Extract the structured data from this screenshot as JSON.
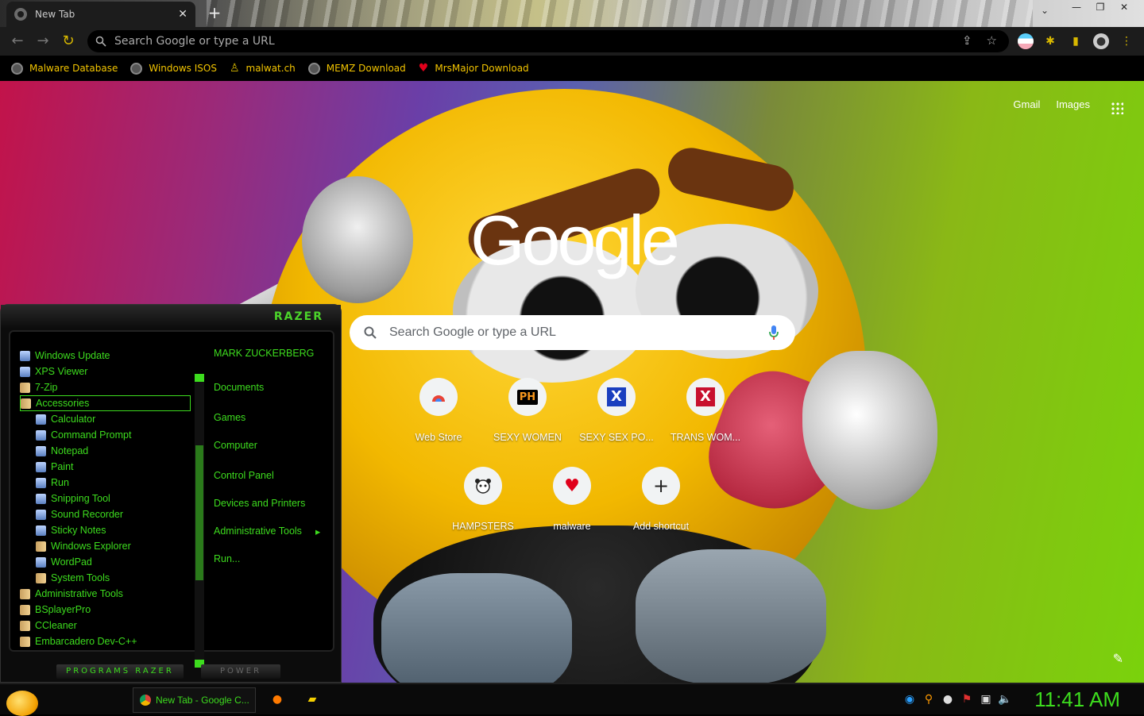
{
  "browser": {
    "tab": {
      "title": "New Tab",
      "close": "✕"
    },
    "newtab_symbol": "+",
    "window_controls": [
      "—",
      "❐",
      "✕"
    ],
    "omnibox": {
      "placeholder": "Search Google or type a URL"
    },
    "bookmarks": [
      {
        "label": "Malware Database",
        "icon": "globe-icon"
      },
      {
        "label": "Windows ISOS",
        "icon": "globe-icon"
      },
      {
        "label": "malwat.ch",
        "icon": "person-icon"
      },
      {
        "label": "MEMZ Download",
        "icon": "globe-icon"
      },
      {
        "label": "MrsMajor Download",
        "icon": "heart-icon"
      }
    ]
  },
  "ntp": {
    "links": {
      "gmail": "Gmail",
      "images": "Images"
    },
    "logo": "Google",
    "search_placeholder": "Search Google or type a URL",
    "shortcuts": [
      {
        "label": "Web Store",
        "icon": "web-store-icon"
      },
      {
        "label": "SEXY WOMEN",
        "icon": "ph-icon",
        "glyph": "PH"
      },
      {
        "label": "SEXY SEX PO...",
        "icon": "x-blue-icon",
        "glyph": "X"
      },
      {
        "label": "TRANS WOM...",
        "icon": "x-red-icon",
        "glyph": "X"
      },
      {
        "label": "HAMPSTERS",
        "icon": "hamster-icon"
      },
      {
        "label": "malware",
        "icon": "heart-icon",
        "glyph": "♥"
      },
      {
        "label": "Add shortcut",
        "icon": "plus-icon",
        "glyph": "+"
      }
    ]
  },
  "startmenu": {
    "brand": "RAZER",
    "programs": [
      {
        "label": "Windows Update",
        "kind": "app",
        "sub": false
      },
      {
        "label": "XPS Viewer",
        "kind": "app",
        "sub": false
      },
      {
        "label": "7-Zip",
        "kind": "folder",
        "sub": false
      },
      {
        "label": "Accessories",
        "kind": "folder",
        "sub": false,
        "selected": true
      },
      {
        "label": "Calculator",
        "kind": "app",
        "sub": true
      },
      {
        "label": "Command Prompt",
        "kind": "app",
        "sub": true
      },
      {
        "label": "Notepad",
        "kind": "app",
        "sub": true
      },
      {
        "label": "Paint",
        "kind": "app",
        "sub": true
      },
      {
        "label": "Run",
        "kind": "app",
        "sub": true
      },
      {
        "label": "Snipping Tool",
        "kind": "app",
        "sub": true
      },
      {
        "label": "Sound Recorder",
        "kind": "app",
        "sub": true
      },
      {
        "label": "Sticky Notes",
        "kind": "app",
        "sub": true
      },
      {
        "label": "Windows Explorer",
        "kind": "folder",
        "sub": true
      },
      {
        "label": "WordPad",
        "kind": "app",
        "sub": true
      },
      {
        "label": "System Tools",
        "kind": "folder",
        "sub": true
      },
      {
        "label": "Administrative Tools",
        "kind": "folder",
        "sub": false
      },
      {
        "label": "BSplayerPro",
        "kind": "folder",
        "sub": false
      },
      {
        "label": "CCleaner",
        "kind": "folder",
        "sub": false
      },
      {
        "label": "Embarcadero Dev-C++",
        "kind": "folder",
        "sub": false
      }
    ],
    "right": [
      "MARK ZUCKERBERG",
      "Documents",
      "Games",
      "Computer",
      "Control Panel",
      "Devices and Printers",
      "Administrative Tools",
      "Run..."
    ],
    "submenu_arrow": "▸",
    "footer_programs": "PROGRAMS  RAZER",
    "footer_power": "POWER"
  },
  "taskbar": {
    "task_label": "New Tab - Google C...",
    "clock": "11:41 AM"
  },
  "colors": {
    "accent_green": "#3ddc1e",
    "bookmark_yellow": "#f2c400"
  }
}
